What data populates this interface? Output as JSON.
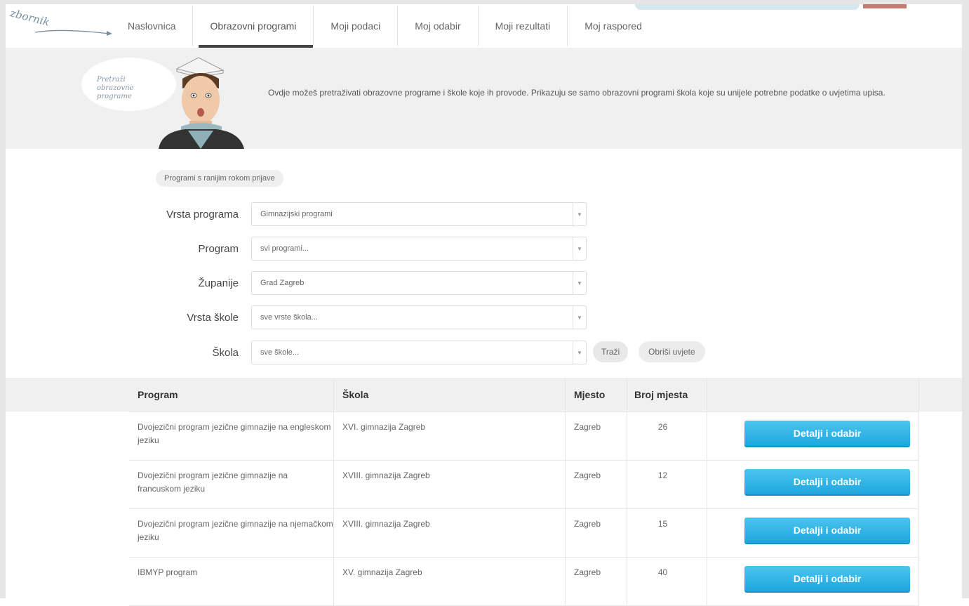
{
  "logo": {
    "text": "zbornik"
  },
  "nav": {
    "items": [
      {
        "label": "Naslovnica"
      },
      {
        "label": "Obrazovni programi"
      },
      {
        "label": "Moji podaci"
      },
      {
        "label": "Moj odabir"
      },
      {
        "label": "Moji rezultati"
      },
      {
        "label": "Moj raspored"
      }
    ],
    "active_index": 1
  },
  "hero": {
    "bubble_text": "Pretraži obrazovne programe",
    "description": "Ovdje možeš pretraživati obrazovne programe i škole koje ih provode. Prikazuju se samo obrazovni programi škola koje su unijele potrebne podatke o uvjetima upisa."
  },
  "filters": {
    "early_label": "Programi s ranijim rokom prijave",
    "rows": [
      {
        "label": "Vrsta programa",
        "value": "Gimnazijski programi"
      },
      {
        "label": "Program",
        "value": "svi programi..."
      },
      {
        "label": "Županije",
        "value": "Grad Zagreb"
      },
      {
        "label": "Vrsta škole",
        "value": "sve vrste škola..."
      },
      {
        "label": "Škola",
        "value": "sve škole..."
      }
    ],
    "search_label": "Traži",
    "clear_label": "Obriši uvjete"
  },
  "table": {
    "headers": {
      "program": "Program",
      "school": "Škola",
      "city": "Mjesto",
      "seats": "Broj mjesta"
    },
    "button_label": "Detalji i odabir",
    "rows": [
      {
        "program": "Dvojezični program jezične gimnazije na engleskom jeziku",
        "school": "XVI. gimnazija Zagreb",
        "city": "Zagreb",
        "seats": "26"
      },
      {
        "program": "Dvojezični program jezične gimnazije na francuskom jeziku",
        "school": "XVIII. gimnazija Zagreb",
        "city": "Zagreb",
        "seats": "12"
      },
      {
        "program": "Dvojezični program jezične gimnazije na njemačkom jeziku",
        "school": "XVIII. gimnazija Zagreb",
        "city": "Zagreb",
        "seats": "15"
      },
      {
        "program": "IBMYP program",
        "school": "XV. gimnazija Zagreb",
        "city": "Zagreb",
        "seats": "40"
      }
    ]
  },
  "colors": {
    "accent_button": "#2ab3e6",
    "band": "#f0f0f0",
    "nav_active": "#444444"
  }
}
